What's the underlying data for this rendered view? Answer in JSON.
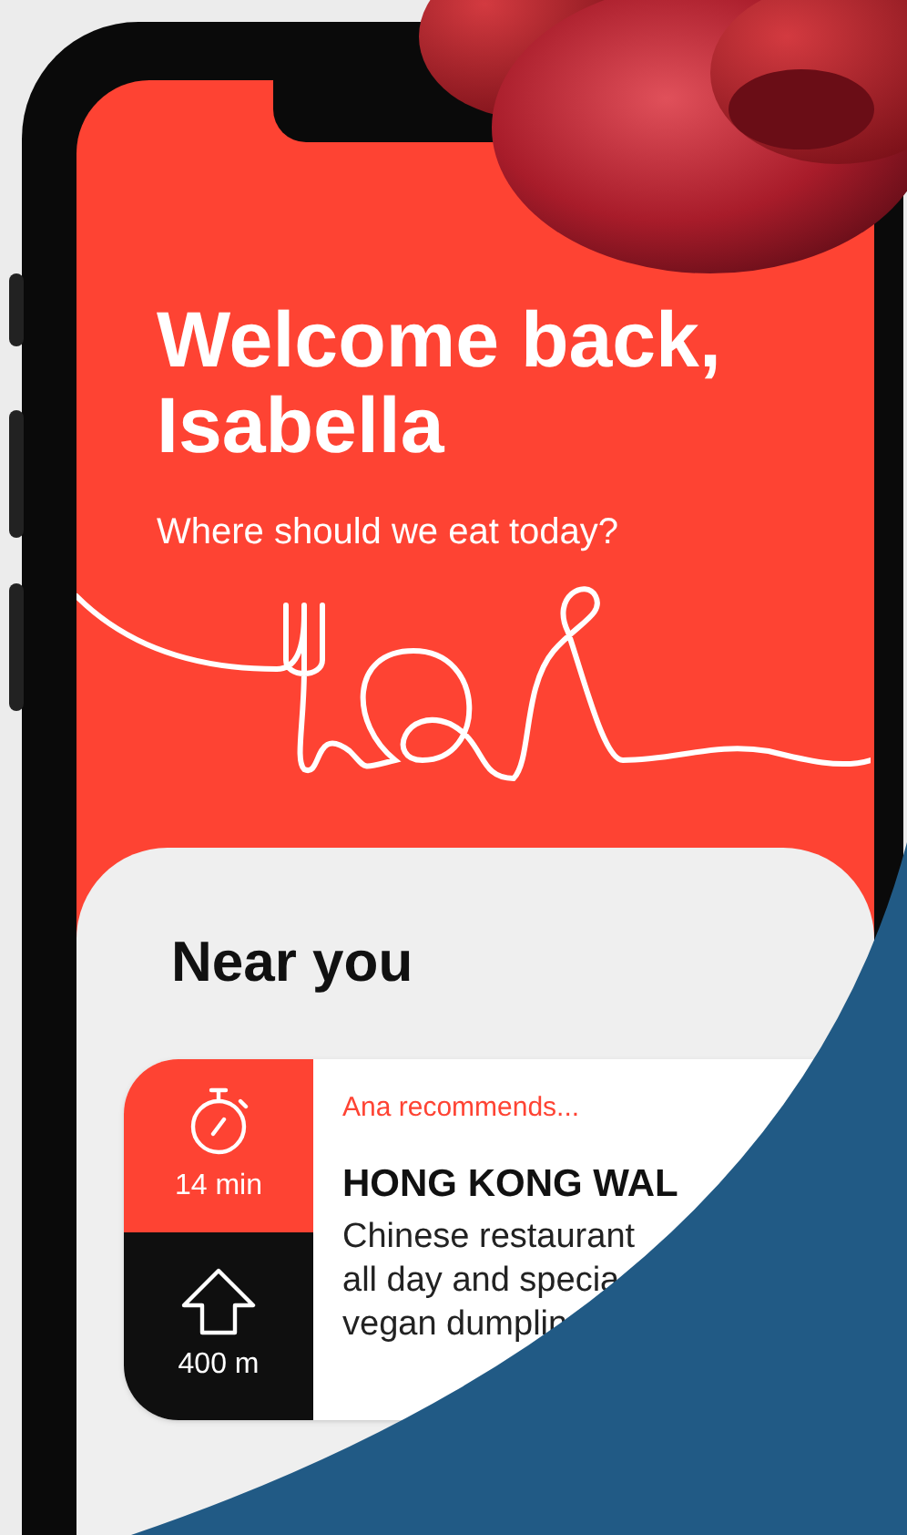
{
  "greeting": {
    "title": "Welcome back, Isabella",
    "subtitle": "Where should we eat today?"
  },
  "section": {
    "title": "Near you"
  },
  "card": {
    "time": "14 min",
    "distance": "400 m",
    "recommender": "Ana recommends...",
    "name": "HONG KONG WAL",
    "description": [
      "Chinese restaurant",
      "all day and specia",
      "vegan dumplin"
    ]
  }
}
